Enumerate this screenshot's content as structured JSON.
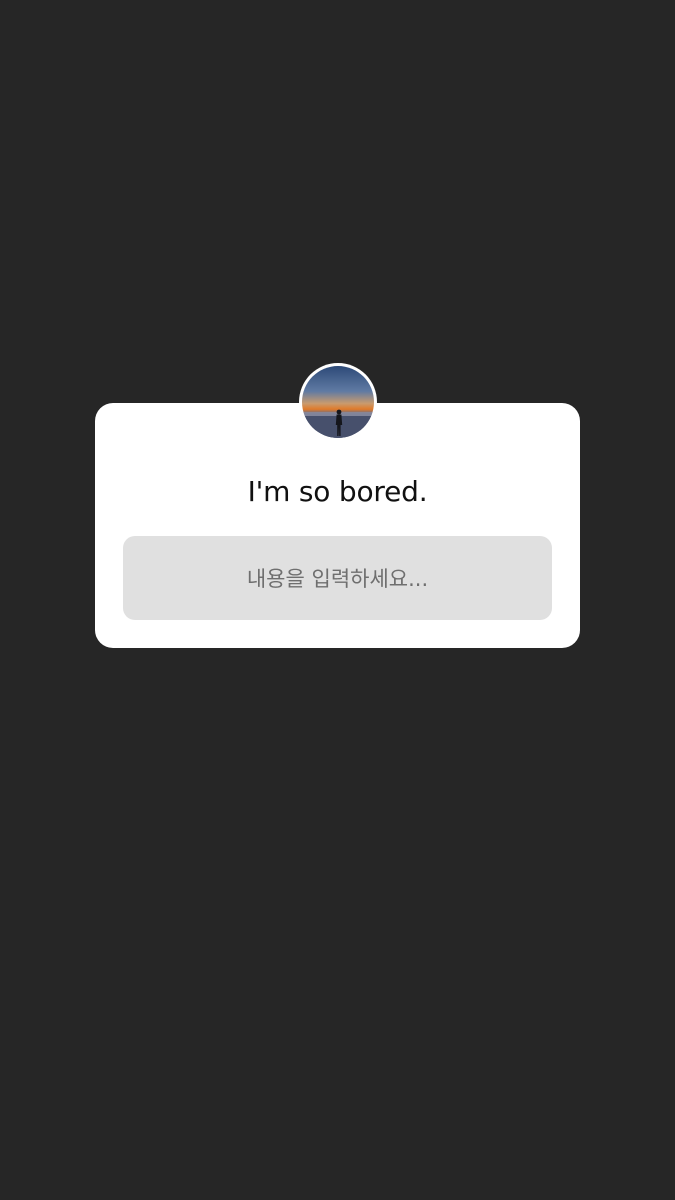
{
  "background_color": "#262626",
  "question_sticker": {
    "avatar_icon": "profile-photo-sunset-silhouette",
    "question_text": "I'm so bored.",
    "answer_placeholder": "내용을 입력하세요..."
  },
  "colors": {
    "card": "#ffffff",
    "answer_box": "#e0e0e0",
    "question_text": "#111111",
    "placeholder_text": "#6f6f6f"
  }
}
